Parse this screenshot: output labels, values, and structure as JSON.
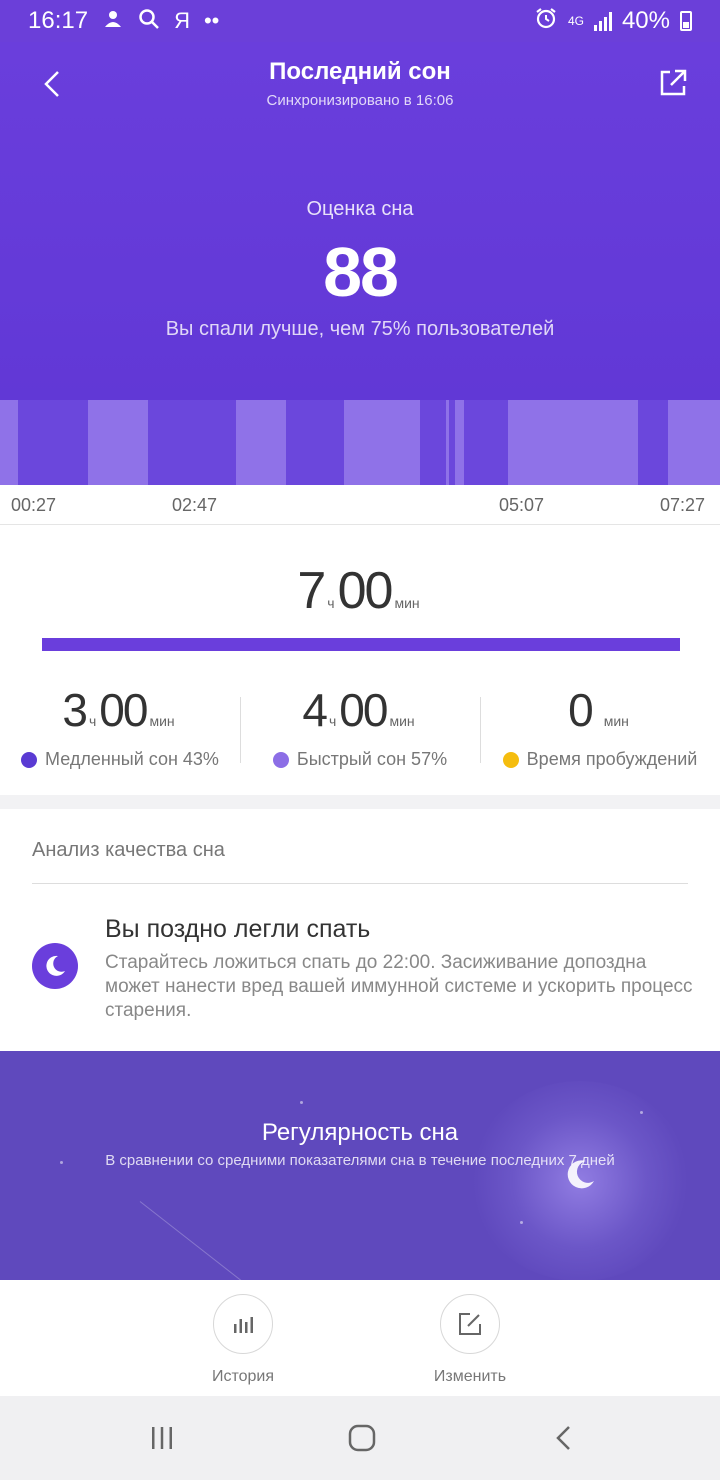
{
  "status_bar": {
    "time": "16:17",
    "icons_left": [
      "notification-icon",
      "search-icon",
      "yandex-icon",
      "more-dots-icon"
    ],
    "yandex_glyph": "Я",
    "more_glyph": "••",
    "network": "4G",
    "battery": "40%",
    "battery_level": 0.4
  },
  "header": {
    "title": "Последний сон",
    "subtitle": "Синхронизировано в 16:06",
    "score_label": "Оценка сна",
    "score": "88",
    "comparison": "Вы спали лучше, чем 75% пользователей"
  },
  "timeline": {
    "times": [
      "00:27",
      "02:47",
      "05:07",
      "07:27"
    ]
  },
  "summary": {
    "total_hours": "7",
    "total_minutes": "00",
    "hours_unit": "ч",
    "minutes_unit": "мин",
    "columns": [
      {
        "hours": "3",
        "minutes": "00",
        "label": "Медленный сон 43%",
        "color": "#5a3bd3"
      },
      {
        "hours": "4",
        "minutes": "00",
        "label": "Быстрый сон 57%",
        "color": "#8c6ee6"
      },
      {
        "value": "0",
        "label": "Время пробуждений",
        "color": "#f5bd0f"
      }
    ]
  },
  "analysis": {
    "title": "Анализ качества сна",
    "item_title": "Вы поздно легли спать",
    "item_text": "Старайтесь ложиться спать до 22:00. Засиживание допоздна может нанести вред вашей иммунной системе и ускорить процесс старения."
  },
  "regularity": {
    "title": "Регулярность сна",
    "subtitle": "В сравнении со средними показателями сна в течение последних 7 дней"
  },
  "actions": {
    "history": "История",
    "edit": "Изменить"
  },
  "colors": {
    "brand": "#6a3edc",
    "deep_sleep": "#6b47dc",
    "light_sleep": "#8f72e8",
    "wake": "#f5bd0f"
  }
}
